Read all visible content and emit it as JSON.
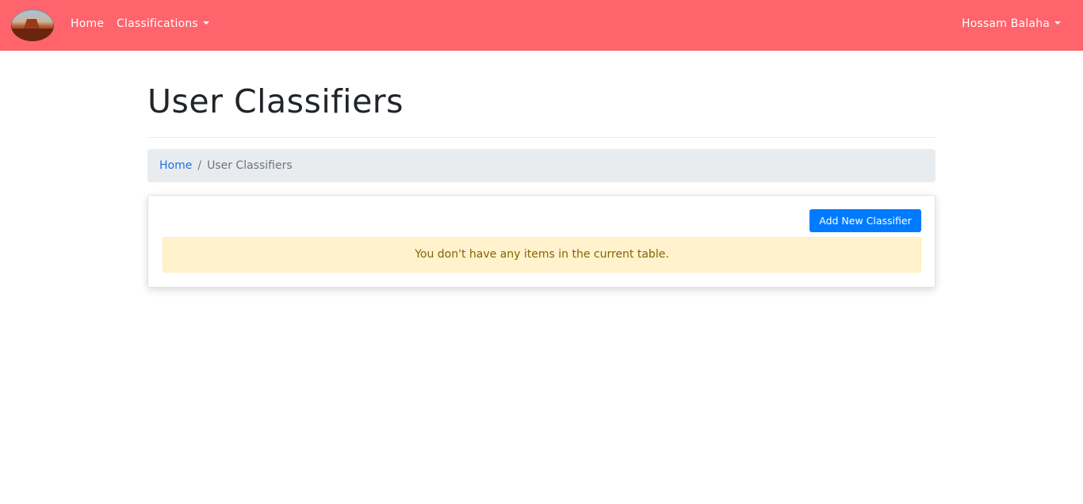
{
  "navbar": {
    "logo_icon": "landscape-logo-icon",
    "home_label": "Home",
    "classifications_label": "Classifications",
    "user_label": "Hossam Balaha",
    "background": "#ff636b"
  },
  "header": {
    "title": "User Classifiers"
  },
  "breadcrumb": {
    "home_label": "Home",
    "separator": "/",
    "current_label": "User Classifiers"
  },
  "card": {
    "add_button_label": "Add New Classifier",
    "empty_message": "You don't have any items in the current table."
  },
  "colors": {
    "navbar": "#ff636b",
    "primary": "#007bff",
    "link": "#1a73e8",
    "alert_bg": "#fff2cc",
    "alert_text": "#856404"
  }
}
